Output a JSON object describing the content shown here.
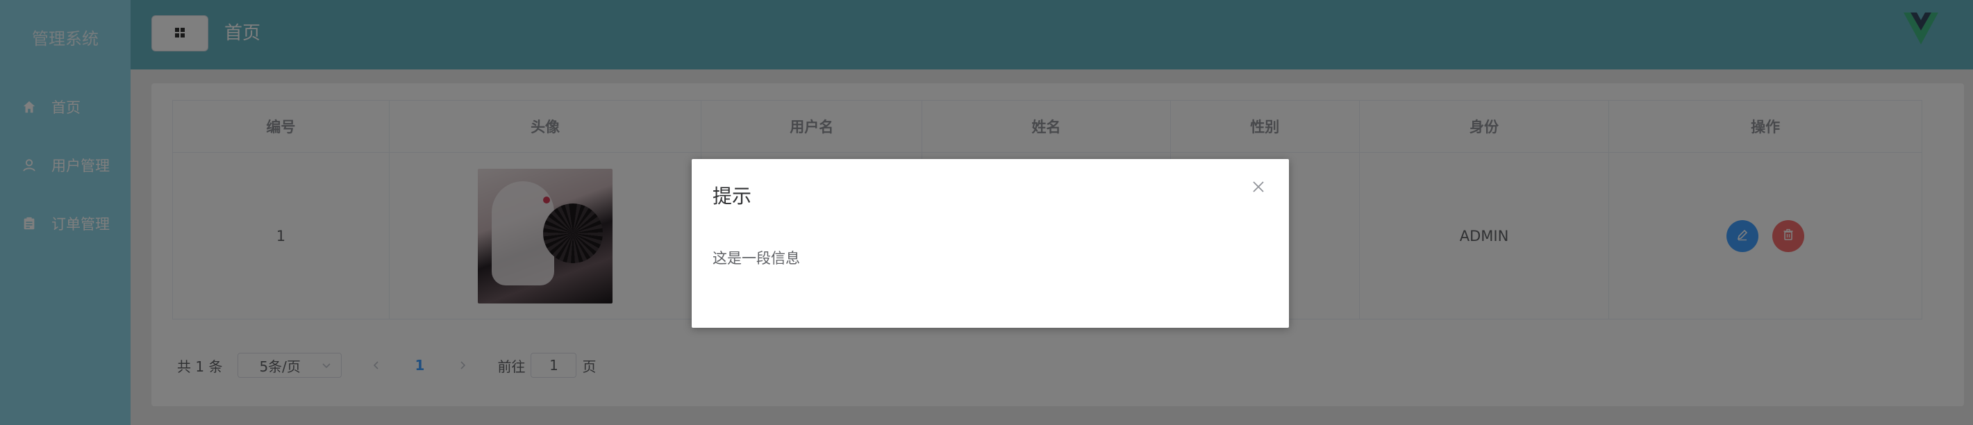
{
  "sidebar": {
    "title": "管理系统",
    "items": [
      {
        "label": "首页",
        "icon": "home-icon"
      },
      {
        "label": "用户管理",
        "icon": "user-icon"
      },
      {
        "label": "订单管理",
        "icon": "order-icon"
      }
    ]
  },
  "header": {
    "breadcrumb": "首页",
    "toggle_icon": "grid-icon",
    "logo_icon": "vue-logo-icon"
  },
  "table": {
    "columns": [
      "编号",
      "头像",
      "用户名",
      "姓名",
      "性别",
      "身份",
      "操作"
    ],
    "rows": [
      {
        "id": "1",
        "username": "",
        "name": "",
        "gender": "",
        "role": "ADMIN"
      }
    ]
  },
  "pagination": {
    "total": "共 1 条",
    "page_size": "5条/页",
    "current_page": "1",
    "goto_label": "前往",
    "goto_value": "1",
    "goto_suffix": "页"
  },
  "dialog": {
    "title": "提示",
    "message": "这是一段信息"
  },
  "colors": {
    "sidebar": "#8ed5e6",
    "header": "#64b3c1",
    "primary": "#409eff",
    "danger": "#f56c6c"
  }
}
